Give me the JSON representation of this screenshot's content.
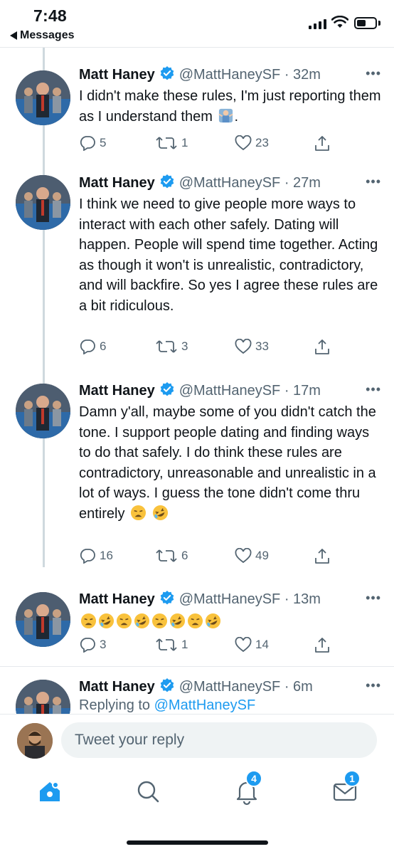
{
  "status_bar": {
    "time": "7:48",
    "back_label": "Messages"
  },
  "colors": {
    "accent": "#1d9bf0",
    "text": "#0f1419",
    "secondary": "#536471"
  },
  "tweets": [
    {
      "name": "Matt Haney",
      "handle_time": "@MattHaneySF · 32m",
      "text": "I didn't make these rules, I'm just reporting them as I understand them",
      "text_suffix": ".",
      "emoji": [
        "person-shrugging"
      ],
      "replies": "5",
      "retweets": "1",
      "likes": "23"
    },
    {
      "name": "Matt Haney",
      "handle_time": "@MattHaneySF · 27m",
      "text": "I think we need to give people more ways to interact with each other safely. Dating will happen. People will spend time together. Acting as though it won't is unrealistic, contradictory, and will backfire. So yes I agree these rules are a bit ridiculous.",
      "replies": "6",
      "retweets": "3",
      "likes": "33"
    },
    {
      "name": "Matt Haney",
      "handle_time": "@MattHaneySF · 17m",
      "text": "Damn y'all, maybe some of you didn't catch the tone. I support people dating and finding ways to do that safely. I do think these rules are contradictory, unreasonable and unrealistic in a lot of ways. I guess the tone didn't come thru entirely",
      "emoji": [
        "weary-face",
        "rolling-laughing-face"
      ],
      "replies": "16",
      "retweets": "6",
      "likes": "49"
    },
    {
      "name": "Matt Haney",
      "handle_time": "@MattHaneySF · 13m",
      "emoji": [
        "weary-face",
        "rolling-laughing-face",
        "weary-face",
        "rolling-laughing-face",
        "weary-face",
        "rolling-laughing-face",
        "weary-face",
        "rolling-laughing-face"
      ],
      "replies": "3",
      "retweets": "1",
      "likes": "14"
    },
    {
      "name": "Matt Haney",
      "handle_time": "@MattHaneySF · 6m",
      "replying_prefix": "Replying to",
      "replying_handle": "@MattHaneySF"
    }
  ],
  "composer": {
    "placeholder": "Tweet your reply"
  },
  "tabbar": {
    "notifications_badge": "4",
    "messages_badge": "1"
  }
}
